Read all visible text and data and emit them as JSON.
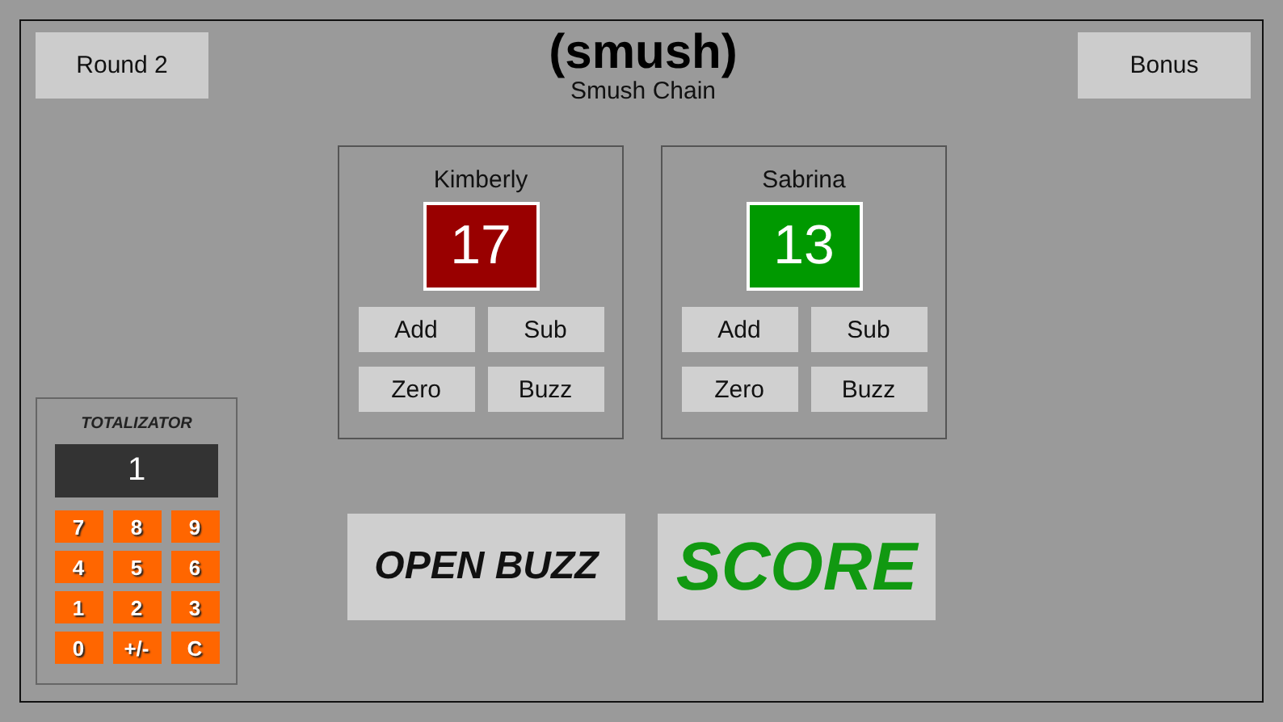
{
  "header": {
    "round_button": "Round 2",
    "title": "(smush)",
    "subtitle": "Smush Chain",
    "bonus_button": "Bonus"
  },
  "players": [
    {
      "name": "Kimberly",
      "score": "17",
      "color": "#990000",
      "buttons": [
        "Add",
        "Sub",
        "Zero",
        "Buzz"
      ]
    },
    {
      "name": "Sabrina",
      "score": "13",
      "color": "#009900",
      "buttons": [
        "Add",
        "Sub",
        "Zero",
        "Buzz"
      ]
    }
  ],
  "actions": [
    {
      "label": "OPEN BUZZ",
      "kind": "open"
    },
    {
      "label": "SCORE",
      "kind": "score"
    }
  ],
  "totalizator": {
    "title": "TOTALIZATOR",
    "display": "1",
    "keys": [
      "7",
      "8",
      "9",
      "4",
      "5",
      "6",
      "1",
      "2",
      "3",
      "0",
      "+/-",
      "C"
    ]
  }
}
